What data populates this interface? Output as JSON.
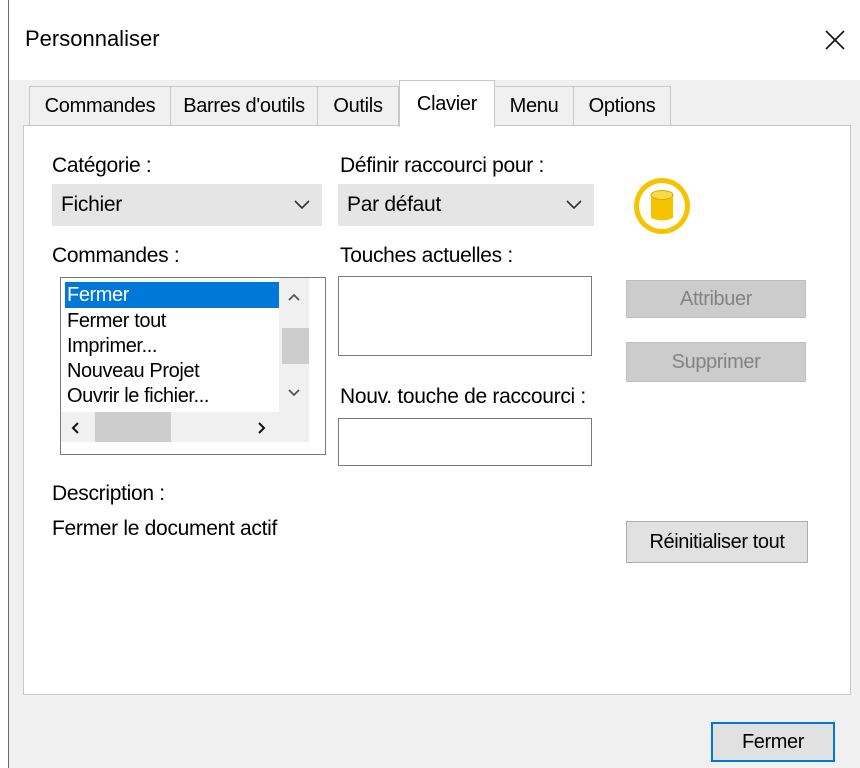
{
  "window": {
    "title": "Personnaliser"
  },
  "tabs": [
    {
      "label": "Commandes"
    },
    {
      "label": "Barres d'outils"
    },
    {
      "label": "Outils"
    },
    {
      "label": "Clavier"
    },
    {
      "label": "Menu"
    },
    {
      "label": "Options"
    }
  ],
  "active_tab": "Clavier",
  "category": {
    "label": "Catégorie :",
    "value": "Fichier"
  },
  "shortcut_scope": {
    "label": "Définir raccourci pour :",
    "value": "Par défaut"
  },
  "commands": {
    "label": "Commandes :",
    "items": [
      "Fermer",
      "Fermer tout",
      "Imprimer...",
      "Nouveau Projet",
      "Ouvrir le fichier..."
    ],
    "selected": "Fermer"
  },
  "current_keys": {
    "label": "Touches actuelles :",
    "value": ""
  },
  "new_shortcut": {
    "label": "Nouv. touche de raccourci :",
    "value": ""
  },
  "buttons": {
    "assign": "Attribuer",
    "remove": "Supprimer",
    "reset_all": "Réinitialiser tout",
    "close": "Fermer"
  },
  "description": {
    "label": "Description :",
    "text": "Fermer le document actif"
  },
  "icons": {
    "scope_icon": "database-icon",
    "close_icon": "close-icon"
  },
  "colors": {
    "selection": "#0078d7",
    "db_icon_ring": "#f5c400"
  }
}
